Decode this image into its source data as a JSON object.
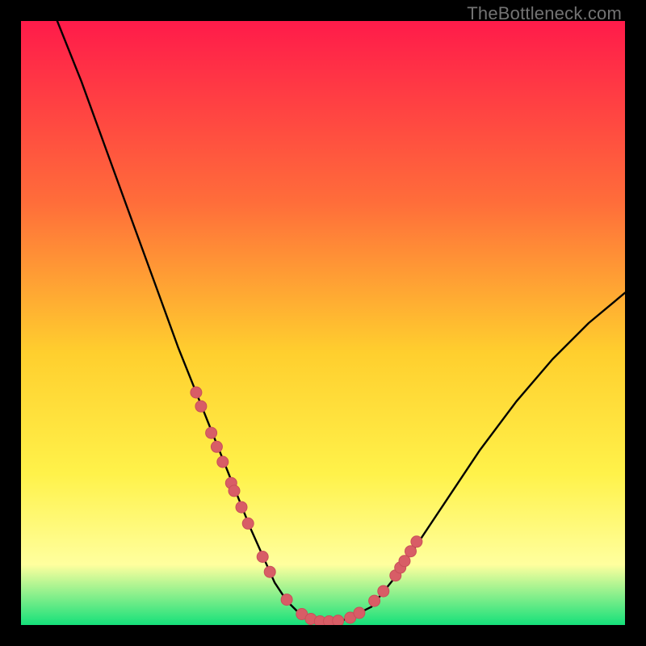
{
  "watermark": "TheBottleneck.com",
  "colors": {
    "bg": "#000000",
    "grad_top": "#ff1b4a",
    "grad_mid1": "#ff6d3a",
    "grad_mid2": "#ffcf2e",
    "grad_mid3": "#fff24a",
    "grad_low": "#ffff9e",
    "grad_bottom": "#15e07a",
    "curve": "#000000",
    "dot_fill": "#d85d66",
    "dot_stroke": "#c94f59"
  },
  "chart_data": {
    "type": "line",
    "title": "",
    "xlabel": "",
    "ylabel": "",
    "xlim": [
      0,
      100
    ],
    "ylim": [
      0,
      100
    ],
    "series": [
      {
        "name": "bottleneck-curve",
        "x": [
          6,
          10,
          14,
          18,
          22,
          26,
          30,
          34,
          38,
          42,
          44,
          46,
          48,
          50,
          52,
          54,
          58,
          62,
          66,
          70,
          76,
          82,
          88,
          94,
          100
        ],
        "y": [
          100,
          90,
          79,
          68,
          57,
          46,
          36,
          26,
          16,
          7,
          4,
          2,
          1,
          0.5,
          0.5,
          1,
          3,
          8,
          14,
          20,
          29,
          37,
          44,
          50,
          55
        ]
      }
    ],
    "dots": {
      "name": "highlight-points",
      "x": [
        29.0,
        29.8,
        31.5,
        32.4,
        33.4,
        34.8,
        35.3,
        36.5,
        37.6,
        40.0,
        41.2,
        44.0,
        46.5,
        48.0,
        49.5,
        51.0,
        52.5,
        54.5,
        56.0,
        58.5,
        60.0,
        62.0,
        62.8,
        63.5,
        64.5,
        65.5
      ],
      "y": [
        38.5,
        36.2,
        31.8,
        29.5,
        27.0,
        23.5,
        22.2,
        19.5,
        16.8,
        11.3,
        8.8,
        4.2,
        1.8,
        1.0,
        0.6,
        0.6,
        0.7,
        1.2,
        2.0,
        4.0,
        5.6,
        8.2,
        9.5,
        10.6,
        12.2,
        13.8
      ]
    }
  }
}
